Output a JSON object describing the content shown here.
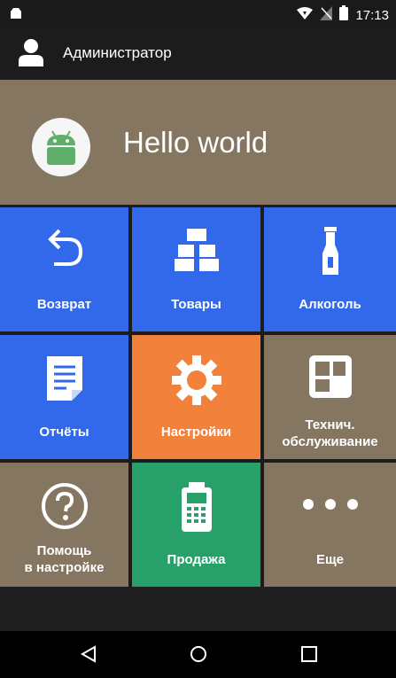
{
  "status_bar": {
    "time": "17:13",
    "icons": [
      "notification-icon",
      "wifi-icon",
      "signal-off-icon",
      "battery-icon"
    ]
  },
  "app_bar": {
    "user_name": "Администратор",
    "icon": "user-icon"
  },
  "hero": {
    "title": "Hello world",
    "icon": "android-icon"
  },
  "tiles": [
    {
      "label": "Возврат",
      "icon": "return-arrow-icon",
      "color": "#3169ea"
    },
    {
      "label": "Товары",
      "icon": "boxes-icon",
      "color": "#3169ea"
    },
    {
      "label": "Алкоголь",
      "icon": "bottle-icon",
      "color": "#3169ea"
    },
    {
      "label": "Отчёты",
      "icon": "document-icon",
      "color": "#3169ea"
    },
    {
      "label": "Настройки",
      "icon": "gear-icon",
      "color": "#f2823b"
    },
    {
      "label_line1": "Технич.",
      "label_line2": "обслуживание",
      "icon": "grid-icon",
      "color": "#857662"
    },
    {
      "label_line1": "Помощь",
      "label_line2": "в настройке",
      "icon": "help-icon",
      "color": "#857662"
    },
    {
      "label": "Продажа",
      "icon": "pos-terminal-icon",
      "color": "#27a06a"
    },
    {
      "label": "Еще",
      "icon": "more-dots-icon",
      "color": "#857662"
    }
  ],
  "nav_bar": {
    "buttons": [
      "back-icon",
      "home-icon",
      "recents-icon"
    ]
  }
}
